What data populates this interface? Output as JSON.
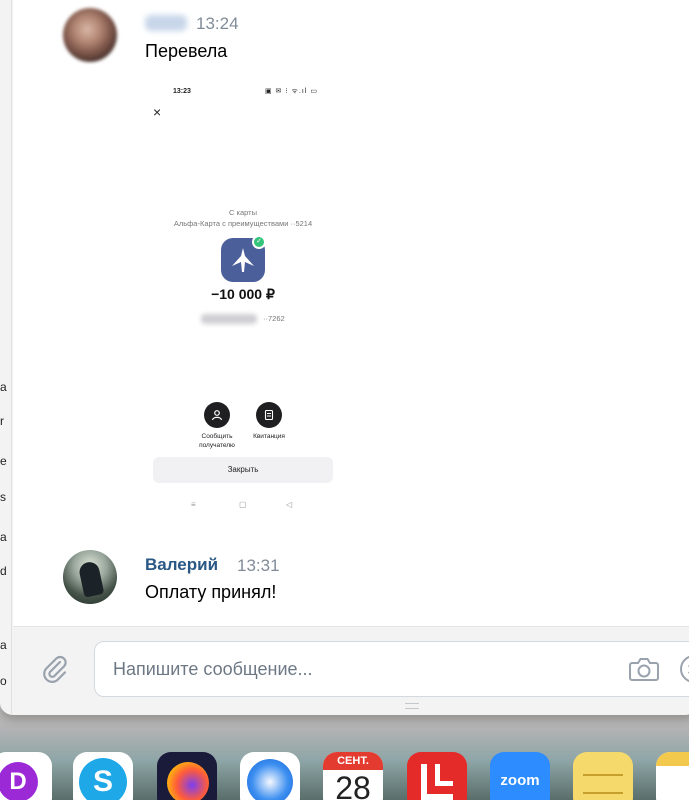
{
  "messages": [
    {
      "time": "13:24",
      "text": "Перевела"
    },
    {
      "author": "Валерий",
      "time": "13:31",
      "text": "Оплату принял!"
    }
  ],
  "attachment": {
    "status_time": "13:23",
    "status_icons": "▣ ✉ ⁝ ᯤ.ıl ▭",
    "close_icon": "×",
    "from_label": "С карты",
    "card_label": "Альфа-Карта с преимуществами ··5214",
    "amount": "−10 000 ₽",
    "recipient_card": "··7262",
    "actions": [
      {
        "label": "Сообщить получателю",
        "icon": "person-icon"
      },
      {
        "label": "Квитанция",
        "icon": "receipt-icon"
      }
    ],
    "close_button": "Закрыть",
    "nav": [
      "≡",
      "▢",
      "◁"
    ]
  },
  "composer": {
    "placeholder": "Напишите сообщение..."
  },
  "left_edge_chars": [
    "a",
    "r",
    "e",
    "s",
    "a",
    "d",
    "a",
    "o"
  ],
  "dock": {
    "calendar_month": "СЕНТ.",
    "calendar_day": "28",
    "zoom_label": "zoom",
    "skype_letter": "S",
    "app1_letter": "D"
  },
  "colors": {
    "author_name": "#2a5885",
    "time_text": "#818c99",
    "bank_logo": "#4b5f9a",
    "success_badge": "#33c37a"
  }
}
